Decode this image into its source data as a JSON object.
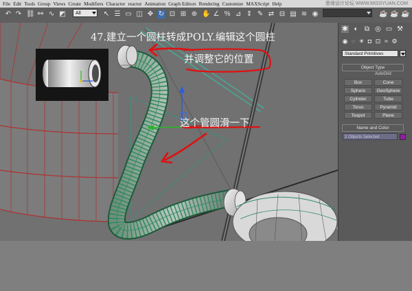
{
  "menubar": {
    "items": [
      "File",
      "Edit",
      "Tools",
      "Group",
      "Views",
      "Create",
      "Modifiers",
      "Character",
      "reactor",
      "Animation",
      "Graph Editors",
      "Rendering",
      "Customize",
      "MAXScript",
      "Help"
    ],
    "watermark": "思缘设计论坛 WWW.MISSYUAN.COM"
  },
  "toolbar": {
    "selection_filter": "All"
  },
  "viewport": {
    "caption_title": "47.建立一个圆柱转成POLY.编辑这个圆柱",
    "caption_adjust": "并调整它的位置",
    "caption_smooth": "这个管圆滑一下"
  },
  "panel": {
    "category": "Standard Primitives",
    "object_type_title": "Object Type",
    "autogrid": "AutoGrid",
    "buttons": [
      "Box",
      "Cone",
      "Sphere",
      "GeoSphere",
      "Cylinder",
      "Tube",
      "Torus",
      "Pyramid",
      "Teapot",
      "Plane"
    ],
    "name_color_title": "Name and Color",
    "name_value": "2 Objects Selected",
    "selection_color": "#8f1fa0"
  },
  "colors": {
    "mesh_green": "#2f8a62",
    "annotation_red": "#e01010"
  }
}
